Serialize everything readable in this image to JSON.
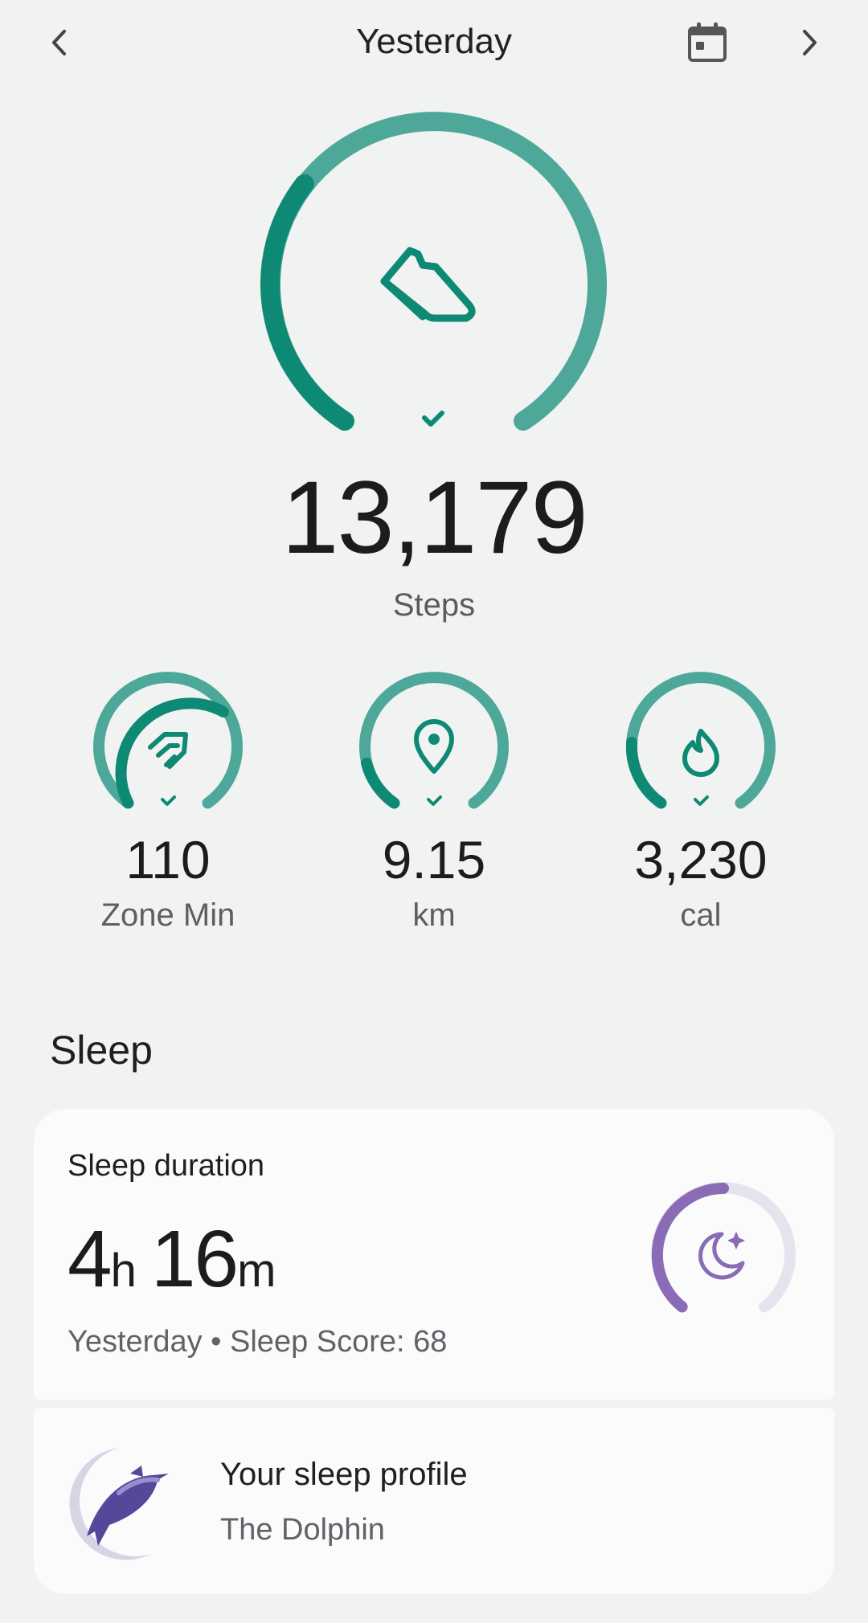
{
  "header": {
    "title": "Yesterday"
  },
  "steps": {
    "value": "13,179",
    "label": "Steps",
    "goal_progress": 1.0
  },
  "metrics": [
    {
      "value": "110",
      "label": "Zone Min",
      "icon": "zone-minutes-icon"
    },
    {
      "value": "9.15",
      "label": "km",
      "icon": "location-pin-icon"
    },
    {
      "value": "3,230",
      "label": "cal",
      "icon": "flame-icon"
    }
  ],
  "sleep": {
    "section_title": "Sleep",
    "card_title": "Sleep duration",
    "hours": "4",
    "hours_unit": "h",
    "minutes": "16",
    "minutes_unit": "m",
    "subtitle": "Yesterday • Sleep Score: 68",
    "profile_title": "Your sleep profile",
    "profile_name": "The Dolphin"
  },
  "colors": {
    "accent_dark": "#0e8a74",
    "accent_light": "#4ea89a",
    "sleep_purple": "#8a6bb5",
    "sleep_track": "#e6e2ee"
  }
}
